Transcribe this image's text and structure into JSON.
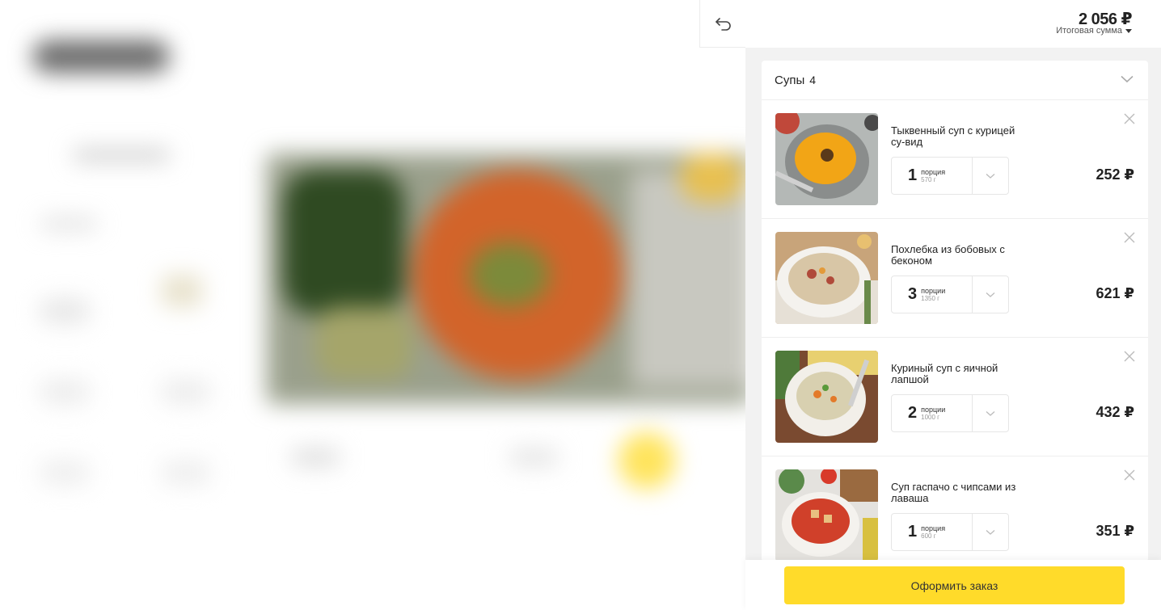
{
  "header": {
    "total_amount": "2 056 ₽",
    "total_label": "Итоговая сумма"
  },
  "icons": {
    "back": "undo-arrow-icon",
    "dropdown": "caret-down-icon",
    "chevron": "chevron-down-icon",
    "close": "close-icon"
  },
  "colors": {
    "accent": "#ffdb2a",
    "panel_bg": "#f2f2f2"
  },
  "section": {
    "title": "Супы",
    "count": "4"
  },
  "items": [
    {
      "name": "Тыквенный суп с курицей су-вид",
      "qty": "1",
      "unit": "порция",
      "weight": "570 г",
      "price": "252 ₽"
    },
    {
      "name": "Похлебка из бобовых с беконом",
      "qty": "3",
      "unit": "порции",
      "weight": "1350 г",
      "price": "621 ₽"
    },
    {
      "name": "Куриный суп с яичной лапшой",
      "qty": "2",
      "unit": "порции",
      "weight": "1000 г",
      "price": "432 ₽"
    },
    {
      "name": "Суп гаспачо с чипсами из лаваша",
      "qty": "1",
      "unit": "порция",
      "weight": "600 г",
      "price": "351 ₽"
    }
  ],
  "footer": {
    "order_button": "Оформить заказ"
  }
}
